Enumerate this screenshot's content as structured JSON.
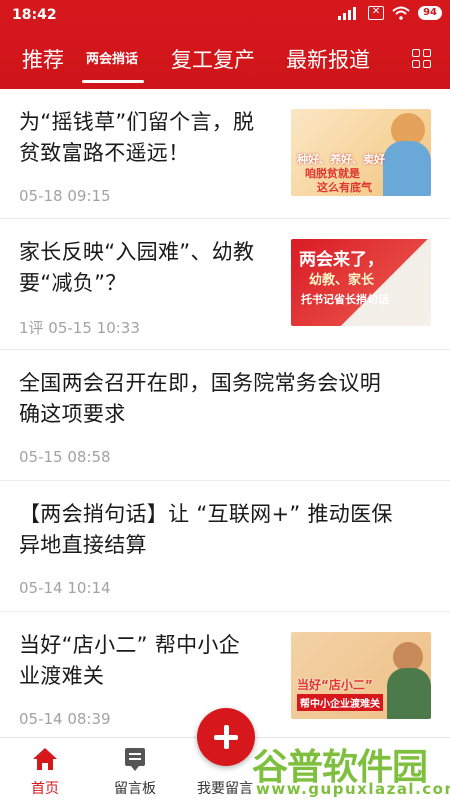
{
  "status": {
    "time": "18:42",
    "battery": "94"
  },
  "tabs": [
    {
      "label": "推荐"
    },
    {
      "label": "两会捎话"
    },
    {
      "label": "复工复产"
    },
    {
      "label": "最新报道"
    }
  ],
  "news": [
    {
      "title_line1": "为“摇钱草”们留个言，脱",
      "title_line2": "贫致富路不遥远！",
      "meta": "05-18 09:15",
      "thumb_lines": [
        "种好、养好、卖好",
        "咱脱贫就是",
        "这么有底气"
      ]
    },
    {
      "title_line1": "家长反映“入园难”、幼教",
      "title_line2": "要“减负”？",
      "meta": "1评   05-15 10:33",
      "thumb_lines": [
        "两会来了，",
        "幼教、家长",
        "托书记省长捎句话"
      ]
    },
    {
      "title_line1": "全国两会召开在即，国务院常务会议明",
      "title_line2": "确这项要求",
      "meta": "05-15 08:58"
    },
    {
      "title_line1": "【两会捎句话】让 “互联网+” 推动医保",
      "title_line2": "异地直接结算",
      "meta": "05-14 10:14"
    },
    {
      "title_line1": "当好“店小二” 帮中小企",
      "title_line2": "业渡难关",
      "meta": "05-14 08:39",
      "thumb_lines": [
        "当好“店小二”",
        "帮中小企业渡难关"
      ]
    }
  ],
  "bottom_nav": [
    {
      "label": "首页",
      "color": "#d6181d"
    },
    {
      "label": "留言板"
    },
    {
      "label": "我要留言"
    }
  ],
  "watermark": {
    "text": "谷普软件园",
    "url": "www.gupuxlazal.com"
  },
  "colors": {
    "brand_red": "#d6181d",
    "meta_gray": "#a3a3a3"
  }
}
